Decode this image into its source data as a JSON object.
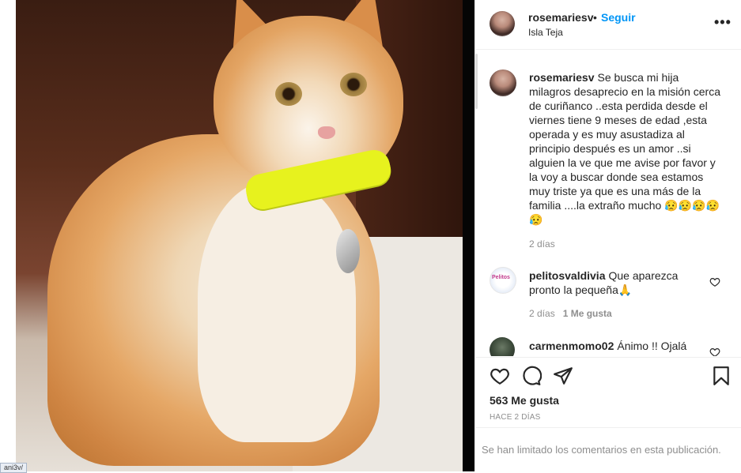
{
  "post": {
    "username": "rosemariesv",
    "separator": "•",
    "follow_label": "Seguir",
    "location": "Isla Teja",
    "more_icon": "more-horizontal-icon",
    "more_label": "•••"
  },
  "caption": {
    "username": "rosemariesv",
    "text": "Se busca mi hija milagros desaprecio en la misión cerca de curiñanco ..esta perdida desde el viernes tiene 9 meses de edad ,esta operada y es muy asustadiza al principio después es un amor ..si alguien la ve que me avise por favor y la voy a buscar donde sea estamos muy triste ya que es una más de la familia ....la extraño mucho 😥😥😥😥😥",
    "time": "2 días"
  },
  "comments": [
    {
      "username": "pelitosvaldivia",
      "text": "Que aparezca pronto la pequeña🙏",
      "time": "2 días",
      "likes": "1 Me gusta",
      "avatar_logo": "Pelitos"
    },
    {
      "username": "carmenmomo02",
      "text": "Ánimo !! Ojalá"
    }
  ],
  "actions": {
    "like_icon": "heart-icon",
    "comment_icon": "comment-icon",
    "share_icon": "paper-plane-icon",
    "save_icon": "bookmark-icon",
    "likes_count": "563 Me gusta",
    "post_time": "HACE 2 DÍAS"
  },
  "footer": {
    "limited_text": "Se han limitado los comentarios en esta publicación."
  },
  "browser": {
    "url_fragment": "ani3v/"
  },
  "colors": {
    "link_blue": "#0095f6",
    "meta_gray": "#8e8e8e",
    "collar_yellow": "#e7f21e"
  }
}
